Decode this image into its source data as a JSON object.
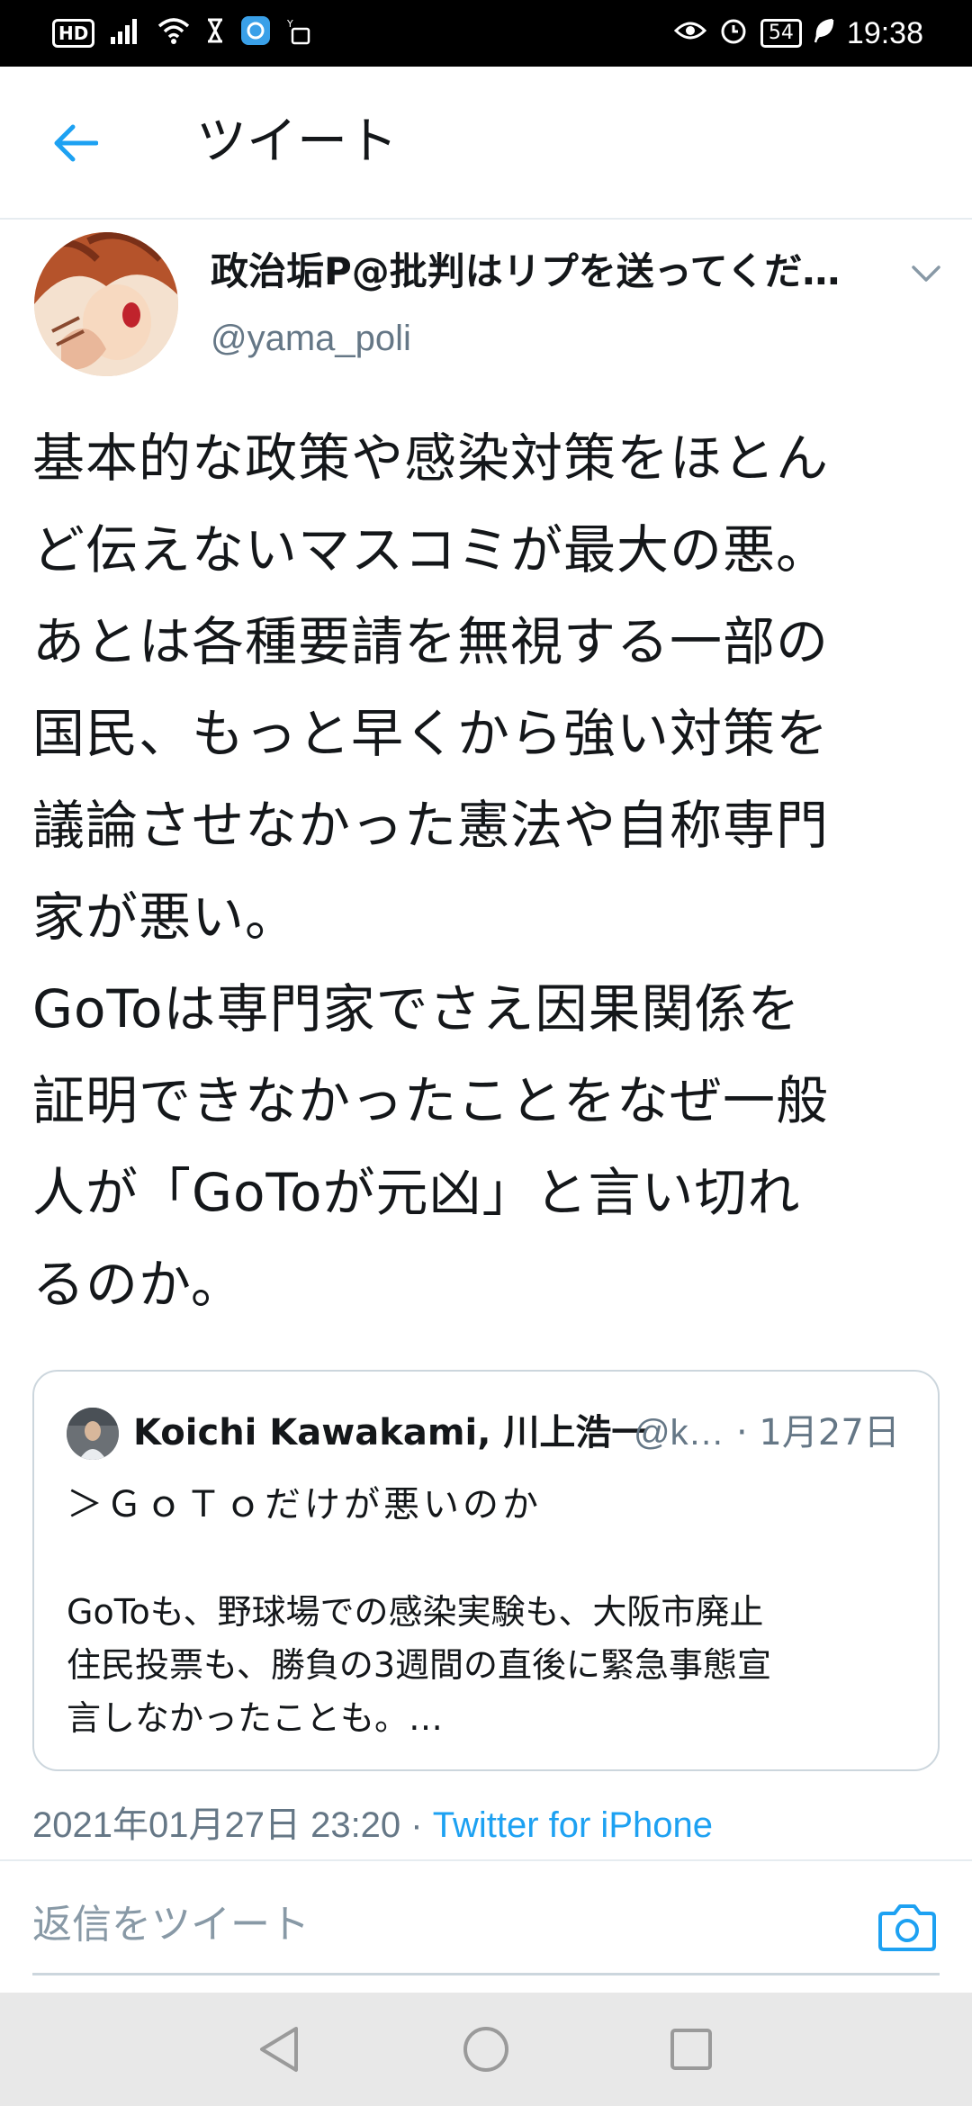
{
  "status_bar": {
    "hd_label": "HD",
    "battery": "54",
    "time": "19:38",
    "icons": [
      "signal-icon",
      "wifi-icon",
      "hourglass-icon",
      "app-icon",
      "data-icon",
      "eye-icon",
      "alarm-icon",
      "leaf-icon"
    ]
  },
  "header": {
    "title": "ツイート",
    "back_icon": "back-arrow-icon"
  },
  "tweet": {
    "author_name": "政治垢P@批判はリプを送ってくだ…",
    "author_handle": "@yama_poli",
    "text": "基本的な政策や感染対策をほとん\nど伝えないマスコミが最大の悪。\nあとは各種要請を無視する一部の\n国民、もっと早くから強い対策を\n議論させなかった憲法や自称専門\n家が悪い。\nGoToは専門家でさえ因果関係を\n証明できなかったことをなぜ一般\n人が「GoToが元凶」と言い切れ\nるのか。",
    "timestamp": "2021年01月27日 23:20",
    "separator": " · ",
    "source": "Twitter for iPhone"
  },
  "quoted_tweet": {
    "author_name": "Koichi Kawakami, 川上浩一",
    "author_handle": "@k…",
    "date": "· 1月27日",
    "line1": "＞ＧｏＴｏだけが悪いのか",
    "body": "GoToも、野球場での感染実験も、大阪市廃止\n住民投票も、勝負の3週間の直後に緊急事態宣\n言しなかったことも。…"
  },
  "reply": {
    "placeholder": "返信をツイート",
    "camera_icon": "camera-icon"
  },
  "colors": {
    "accent": "#1da1f2",
    "secondary_text": "#657786",
    "border": "#ccd6dd"
  }
}
